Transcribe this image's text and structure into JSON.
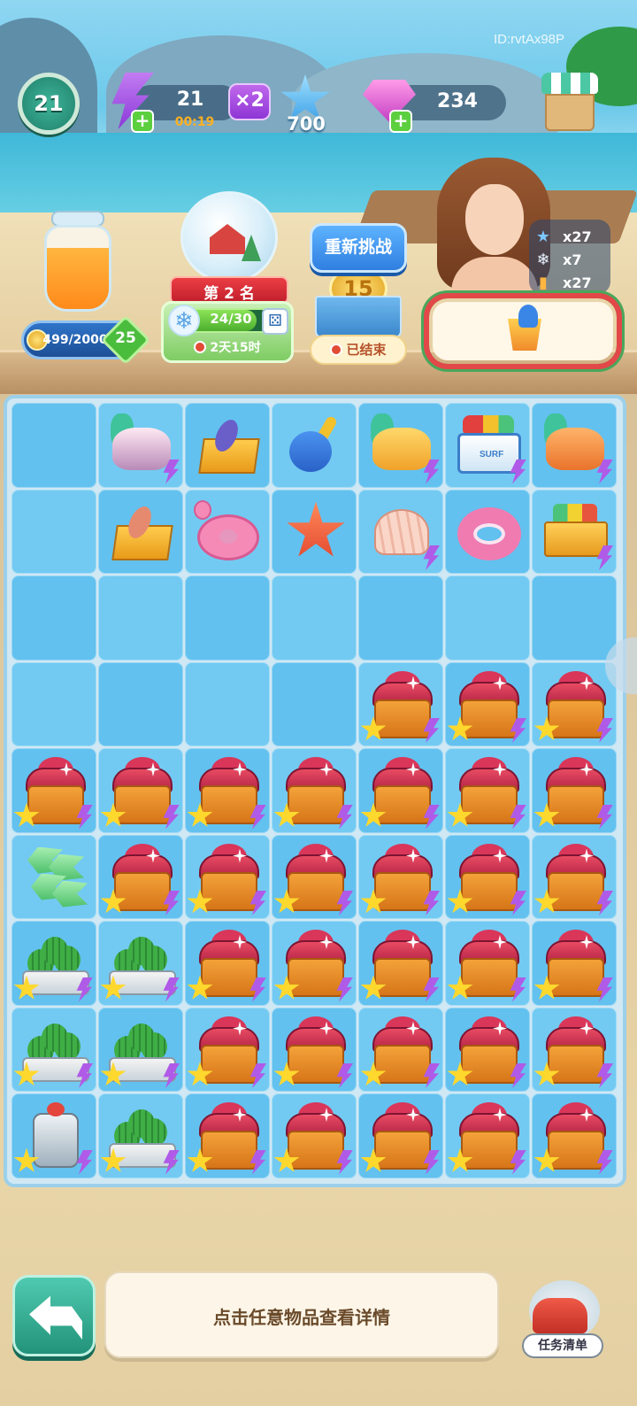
{
  "user_id": "ID:rvtAx98P",
  "player": {
    "level": "21"
  },
  "resources": {
    "energy": "21",
    "energy_timer": "00:19",
    "multiplier": "×2",
    "stars": "700",
    "gems": "234"
  },
  "jar": {
    "progress": "499/2000",
    "level": "25",
    "fill_fraction": 0.25
  },
  "event": {
    "rank": "第 2 名",
    "progress": "24/30",
    "progress_fraction": 0.8,
    "timer": "2天15时"
  },
  "challenge": {
    "retry_label": "重新挑战",
    "coin_value": "15",
    "status": "已结束"
  },
  "rewards": [
    {
      "icon": "blue-star-icon",
      "text": "x27"
    },
    {
      "icon": "snowflake-icon",
      "text": "x7"
    },
    {
      "icon": "juice-icon",
      "text": "x27"
    }
  ],
  "order": {
    "item_icon": "bucket-shovel-icon"
  },
  "board": {
    "columns": 7,
    "rows": 9,
    "cells": [
      "empty",
      "coral-shell-generator",
      "surfboard-basket",
      "toy-shovel",
      "sun-shell-generator",
      "surf-cooler",
      "orange-shell-generator",
      "empty",
      "surf-basket",
      "flamingo-float",
      "starfish",
      "seashell",
      "donut-float",
      "surf-cart",
      "empty",
      "empty",
      "empty",
      "empty",
      "empty",
      "empty",
      "empty",
      "empty",
      "empty",
      "empty",
      "empty",
      "treasure-chest",
      "treasure-chest",
      "treasure-chest",
      "treasure-chest",
      "treasure-chest",
      "treasure-chest",
      "treasure-chest",
      "treasure-chest",
      "treasure-chest",
      "treasure-chest",
      "green-leaves",
      "treasure-chest",
      "treasure-chest",
      "treasure-chest",
      "treasure-chest",
      "treasure-chest",
      "treasure-chest",
      "cactus-planter",
      "cactus-planter",
      "treasure-chest",
      "treasure-chest",
      "treasure-chest",
      "treasure-chest",
      "treasure-chest",
      "cactus-pot",
      "cactus-planter",
      "treasure-chest",
      "treasure-chest",
      "treasure-chest",
      "treasure-chest",
      "treasure-chest",
      "lantern",
      "cactus-pot",
      "treasure-chest",
      "treasure-chest",
      "treasure-chest",
      "treasure-chest",
      "treasure-chest"
    ],
    "starred": [
      25,
      26,
      27,
      28,
      29,
      30,
      31,
      32,
      33,
      34,
      36,
      37,
      38,
      39,
      40,
      41,
      42,
      43,
      44,
      45,
      46,
      47,
      48,
      49,
      50,
      51,
      52,
      53,
      54,
      55,
      56,
      57,
      58,
      59,
      60,
      61,
      62
    ],
    "bolted": [
      1,
      4,
      5,
      6,
      11,
      13,
      25,
      26,
      27,
      28,
      29,
      30,
      31,
      32,
      33,
      34,
      36,
      37,
      38,
      39,
      40,
      41,
      42,
      43,
      44,
      45,
      46,
      47,
      48,
      49,
      50,
      51,
      52,
      53,
      54,
      55,
      56,
      57,
      58,
      59,
      60,
      61,
      62
    ]
  },
  "bottom": {
    "hint": "点击任意物品查看详情",
    "tasks_label": "任务清单"
  },
  "colors": {
    "cell": "#62c1ef",
    "cell_alt": "#72caf2",
    "board_border": "#9cd0ea",
    "accent_green": "#22937a",
    "accent_purple": "#8e35d6"
  }
}
